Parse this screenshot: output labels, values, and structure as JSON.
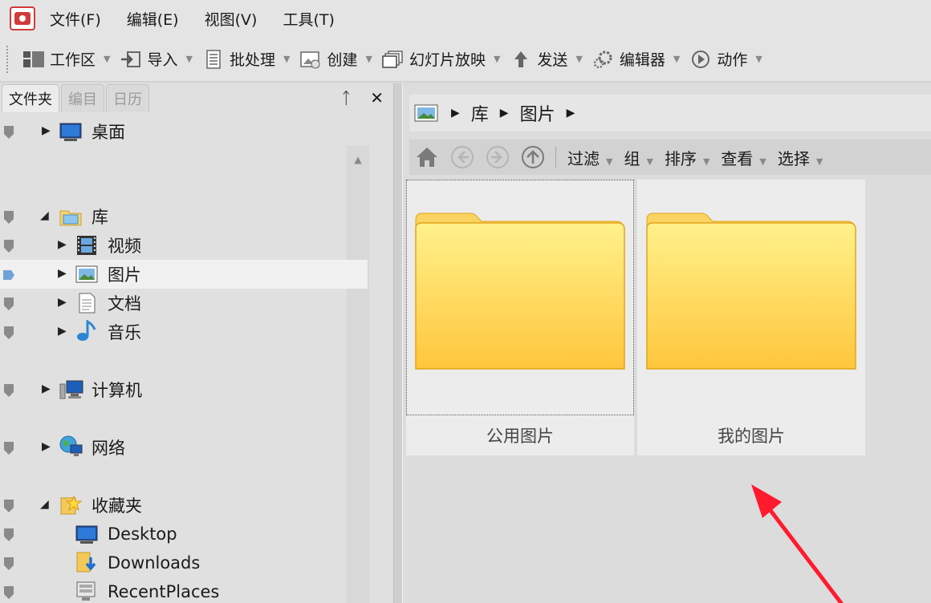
{
  "menu": {
    "items": [
      "文件(F)",
      "编辑(E)",
      "视图(V)",
      "工具(T)"
    ]
  },
  "toolbar": {
    "buttons": [
      {
        "label": "工作区",
        "icon": "workspace-icon"
      },
      {
        "label": "导入",
        "icon": "import-icon"
      },
      {
        "label": "批处理",
        "icon": "batch-icon"
      },
      {
        "label": "创建",
        "icon": "create-icon"
      },
      {
        "label": "幻灯片放映",
        "icon": "slideshow-icon"
      },
      {
        "label": "发送",
        "icon": "send-icon"
      },
      {
        "label": "编辑器",
        "icon": "editor-icon"
      },
      {
        "label": "动作",
        "icon": "action-icon"
      }
    ]
  },
  "leftpanel": {
    "tabs": [
      "文件夹",
      "编目",
      "日历"
    ],
    "pin_glyph": "ᛏ",
    "close_glyph": "✕",
    "tree": [
      {
        "label": "桌面",
        "icon": "desktop-icon"
      },
      {
        "label": "库",
        "icon": "library-icon"
      },
      {
        "label": "视频",
        "icon": "video-icon"
      },
      {
        "label": "图片",
        "icon": "picture-icon"
      },
      {
        "label": "文档",
        "icon": "document-icon"
      },
      {
        "label": "音乐",
        "icon": "music-icon"
      },
      {
        "label": "计算机",
        "icon": "computer-icon"
      },
      {
        "label": "网络",
        "icon": "network-icon"
      },
      {
        "label": "收藏夹",
        "icon": "favorites-icon"
      },
      {
        "label": "Desktop",
        "icon": "desktop-icon"
      },
      {
        "label": "Downloads",
        "icon": "downloads-icon"
      },
      {
        "label": "RecentPlaces",
        "icon": "recent-places-icon"
      }
    ],
    "selected": "图片"
  },
  "address": {
    "crumbs": [
      "库",
      "图片"
    ]
  },
  "navbar": {
    "buttons": [
      "过滤",
      "组",
      "排序",
      "查看",
      "选择"
    ]
  },
  "folders": [
    {
      "name": "公用图片"
    },
    {
      "name": "我的图片"
    }
  ],
  "colors": {
    "folder_top": "#fff18a",
    "folder_bottom": "#ffc63c",
    "folder_stroke": "#e3a41a",
    "annotation_arrow": "#ff1a2e",
    "selection_pin": "#6fa3d8"
  }
}
